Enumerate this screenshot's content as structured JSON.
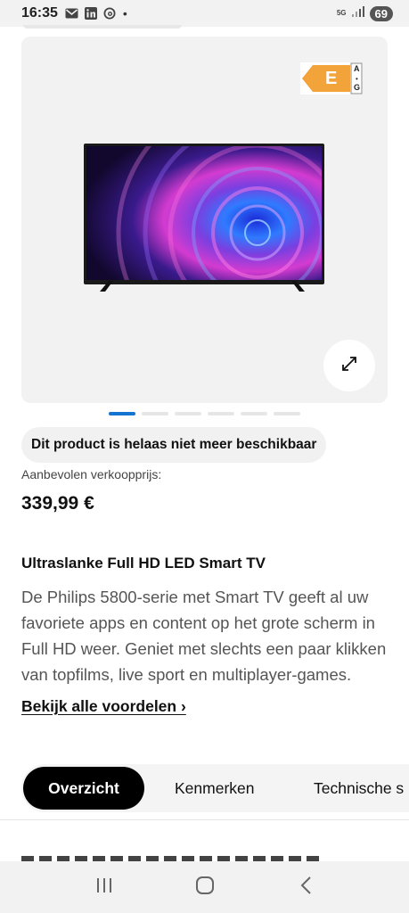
{
  "status_bar": {
    "time": "16:35",
    "network": "5G",
    "battery": "69",
    "icons": [
      "gmail-icon",
      "linkedin-icon",
      "threads-icon",
      "notification-dot-icon",
      "signal-icon"
    ]
  },
  "gallery": {
    "energy_label": {
      "class": "E",
      "scale_top": "A",
      "scale_bottom": "G",
      "color": "#f2a33a"
    },
    "image_icon": "tv-icon",
    "zoom_icon": "expand-icon",
    "pagination": {
      "count": 6,
      "active_index": 0,
      "active_color": "#1474d1"
    }
  },
  "availability": {
    "message": "Dit product is helaas niet meer beschikbaar"
  },
  "pricing": {
    "label": "Aanbevolen verkoopprijs:",
    "price": "339,99 €"
  },
  "product": {
    "headline": "Ultraslanke Full HD LED Smart TV",
    "description": "De Philips 5800-serie met Smart TV geeft al uw favoriete apps en content op het grote scherm in Full HD weer. Geniet met slechts een paar klikken van topfilms, live sport en multiplayer-games.",
    "more_link": "Bekijk alle voordelen ›"
  },
  "tabs": [
    {
      "label": "Overzicht",
      "active": true
    },
    {
      "label": "Kenmerken",
      "active": false
    },
    {
      "label": "Technische s",
      "active": false
    }
  ],
  "nav_bar": {
    "icons": [
      "recent-apps-icon",
      "home-icon",
      "back-icon"
    ]
  }
}
